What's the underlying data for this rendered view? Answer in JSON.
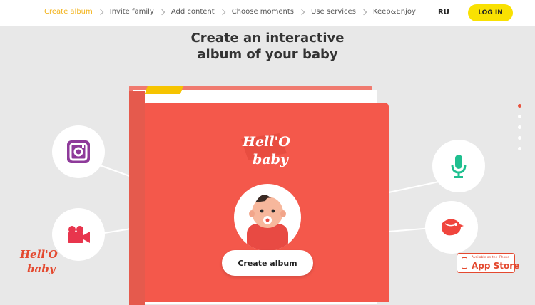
{
  "nav": {
    "steps": [
      {
        "label": "Create album"
      },
      {
        "label": "Invite family"
      },
      {
        "label": "Add content"
      },
      {
        "label": "Choose moments"
      },
      {
        "label": "Use services"
      },
      {
        "label": "Keep&Enjoy"
      }
    ],
    "language": "RU",
    "login_label": "LOG IN"
  },
  "hero": {
    "title_line1": "Create an interactive",
    "title_line2": "album of your baby",
    "cta_label": "Create album"
  },
  "brand": {
    "logo_text": "Hell'O baby"
  },
  "features": {
    "left": [
      "instagram-icon",
      "video-camera-icon"
    ],
    "right": [
      "microphone-icon",
      "twitter-bird-icon"
    ]
  },
  "carousel": {
    "slide_count": 5,
    "active_index": 0
  },
  "app_store": {
    "small_text": "Available on the iPhone",
    "big_text": "App Store"
  },
  "colors": {
    "accent_yellow": "#f9e102",
    "active_step": "#f3b31a",
    "book_red": "#f4584b",
    "instagram_purple": "#8e3a9a",
    "video_red": "#e8354d",
    "mic_green": "#1fbf8f",
    "bird_red": "#f0453d"
  }
}
